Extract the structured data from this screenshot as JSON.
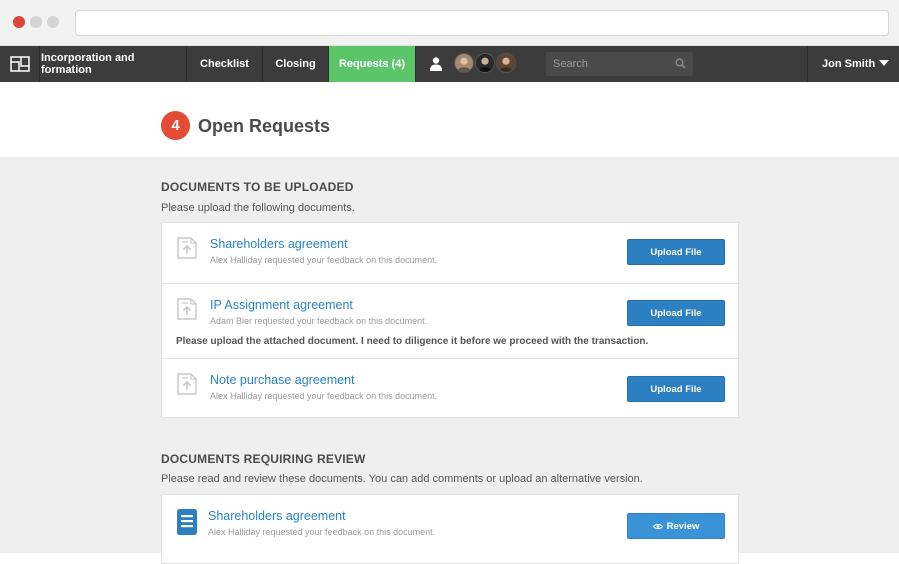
{
  "nav": {
    "tabs": [
      {
        "label": "Incorporation and formation"
      },
      {
        "label": "Checklist"
      },
      {
        "label": "Closing"
      },
      {
        "label": "Requests (4)"
      }
    ],
    "search_placeholder": "Search",
    "user_name": "Jon Smith"
  },
  "header": {
    "count": "4",
    "title": "Open Requests"
  },
  "upload_section": {
    "title": "DOCUMENTS TO BE UPLOADED",
    "subtitle": "Please upload the following documents.",
    "items": [
      {
        "title": "Shareholders agreement",
        "meta": "Alex Halliday requested your feedback on this document.",
        "button": "Upload File"
      },
      {
        "title": "IP Assignment agreement",
        "meta": "Adam Bier requested your feedback on this document.",
        "note": "Please upload the attached document. I need to diligence it before we proceed with the transaction.",
        "button": "Upload File"
      },
      {
        "title": "Note purchase agreement",
        "meta": "Alex Halliday requested your feedback on this document.",
        "button": "Upload File"
      }
    ]
  },
  "review_section": {
    "title": "DOCUMENTS REQUIRING REVIEW",
    "subtitle": "Please read and review these documents. You can add comments or upload an alternative version.",
    "items": [
      {
        "title": "Shareholders agreement",
        "meta": "Alex Halliday requested your feedback on this document.",
        "button": "Review"
      }
    ]
  },
  "colors": {
    "active_tab": "#5cc56a",
    "badge": "#e44b35",
    "button": "#2c7fc0",
    "link": "#2a84c4"
  }
}
